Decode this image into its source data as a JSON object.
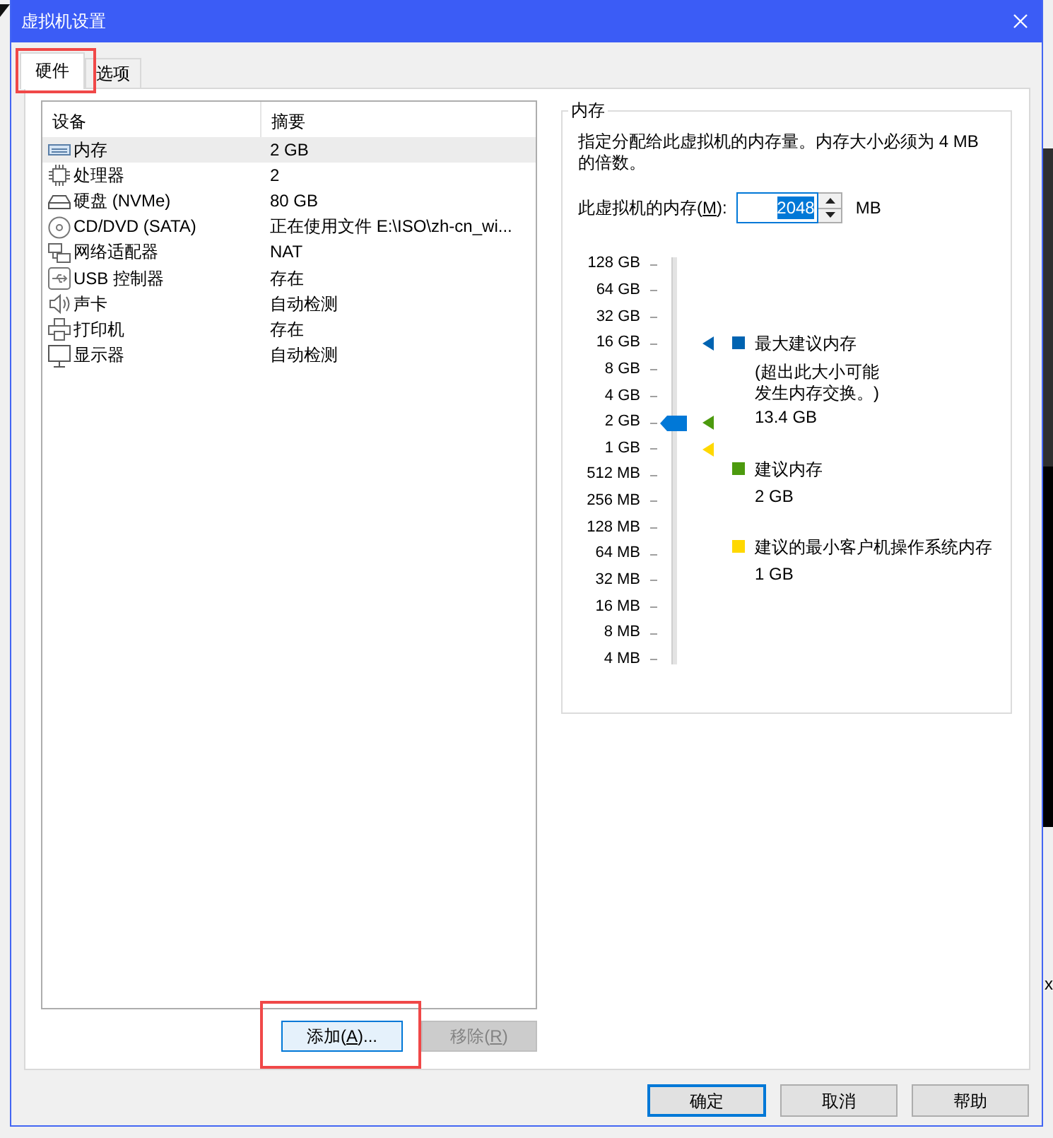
{
  "window": {
    "title": "虚拟机设置"
  },
  "tabs": [
    {
      "label": "硬件",
      "selected": true,
      "annotated": true
    },
    {
      "label": "选项",
      "selected": false,
      "annotated": false
    }
  ],
  "device_list": {
    "columns": [
      "设备",
      "摘要"
    ],
    "rows": [
      {
        "kind": "memory",
        "device": "内存",
        "summary": "2 GB",
        "selected": true
      },
      {
        "kind": "processor",
        "device": "处理器",
        "summary": "2",
        "selected": false
      },
      {
        "kind": "disk",
        "device": "硬盘 (NVMe)",
        "summary": "80 GB",
        "selected": false
      },
      {
        "kind": "cdrom",
        "device": "CD/DVD (SATA)",
        "summary": "正在使用文件 E:\\ISO\\zh-cn_wi...",
        "selected": false
      },
      {
        "kind": "network",
        "device": "网络适配器",
        "summary": "NAT",
        "selected": false
      },
      {
        "kind": "usb",
        "device": "USB 控制器",
        "summary": "存在",
        "selected": false
      },
      {
        "kind": "sound",
        "device": "声卡",
        "summary": "自动检测",
        "selected": false
      },
      {
        "kind": "printer",
        "device": "打印机",
        "summary": "存在",
        "selected": false
      },
      {
        "kind": "display",
        "device": "显示器",
        "summary": "自动检测",
        "selected": false
      }
    ]
  },
  "list_buttons": [
    {
      "text_before": "添加(",
      "access_key": "A",
      "text_after": ")...",
      "focused": true,
      "disabled": false,
      "annotated": true
    },
    {
      "text_before": "移除(",
      "access_key": "R",
      "text_after": ")",
      "focused": false,
      "disabled": true,
      "annotated": false
    }
  ],
  "memory": {
    "title": "内存",
    "description": "指定分配给此虚拟机的内存量。内存大小必须为 4 MB 的倍数。",
    "field": {
      "text_before": "此虚拟机的内存(",
      "access_key": "M",
      "text_after": "):",
      "value": "2048",
      "value_selected": true,
      "unit": "MB"
    },
    "scale": {
      "labels": [
        "128 GB",
        "64 GB",
        "32 GB",
        "16 GB",
        "8 GB",
        "4 GB",
        "2 GB",
        "1 GB",
        "512 MB",
        "256 MB",
        "128 MB",
        "64 MB",
        "32 MB",
        "16 MB",
        "8 MB",
        "4 MB"
      ],
      "level": 0.6,
      "markers": [
        {
          "color": "#0063b1",
          "level": 0.8
        },
        {
          "color": "#4c9a0e",
          "level": 0.6
        },
        {
          "color": "#ffd800",
          "level": 0.5333
        }
      ]
    },
    "legend": [
      {
        "color": "#0063b1",
        "label": "最大建议内存",
        "note": "(超出此大小可能发生内存交换。)",
        "value": "13.4 GB"
      },
      {
        "color": "#4c9a0e",
        "label": "建议内存",
        "value": "2 GB"
      },
      {
        "color": "#ffd800",
        "label": "建议的最小客户机操作系统内存",
        "value": "1 GB"
      }
    ]
  },
  "dialog_buttons": [
    {
      "label": "确定",
      "default": true
    },
    {
      "label": "取消",
      "default": false
    },
    {
      "label": "帮助",
      "default": false
    }
  ],
  "background": {
    "edge_text": "x"
  }
}
